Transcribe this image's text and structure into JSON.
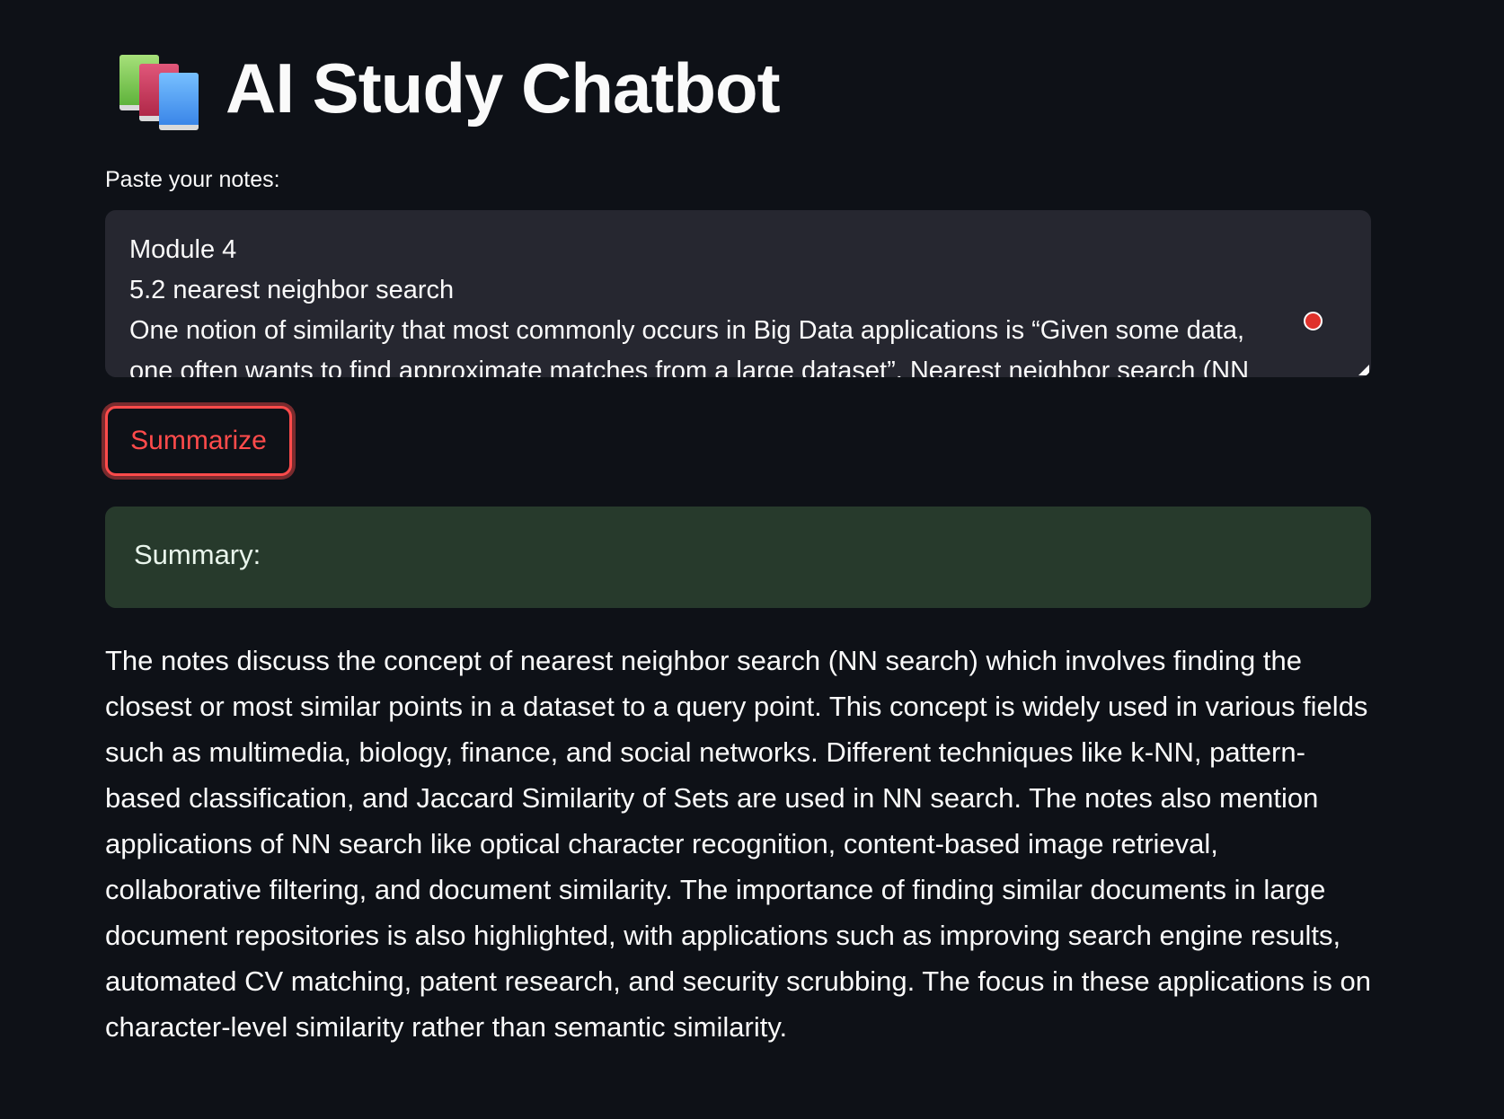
{
  "app": {
    "title": "AI Study Chatbot",
    "title_icon": "books-icon"
  },
  "notes": {
    "label": "Paste your notes:",
    "value": "Module 4\n5.2 nearest neighbor search\nOne notion of similarity that most commonly occurs in Big Data applications is “Given some data,\none often wants to find approximate matches from a large dataset”. Nearest neighbor search (NN"
  },
  "actions": {
    "summarize_label": "Summarize"
  },
  "summary": {
    "heading": "Summary:",
    "text": "The notes discuss the concept of nearest neighbor search (NN search) which involves finding the closest or most similar points in a dataset to a query point. This concept is widely used in various fields such as multimedia, biology, finance, and social networks. Different techniques like k-NN, pattern-based classification, and Jaccard Similarity of Sets are used in NN search. The notes also mention applications of NN search like optical character recognition, content-based image retrieval, collaborative filtering, and document similarity. The importance of finding similar documents in large document repositories is also highlighted, with applications such as improving search engine results, automated CV matching, patent research, and security scrubbing. The focus in these applications is on character-level similarity rather than semantic similarity."
  },
  "colors": {
    "background": "#0e1117",
    "textarea_bg": "#262730",
    "accent": "#ff4b4b",
    "success_bg": "#273a2c"
  }
}
